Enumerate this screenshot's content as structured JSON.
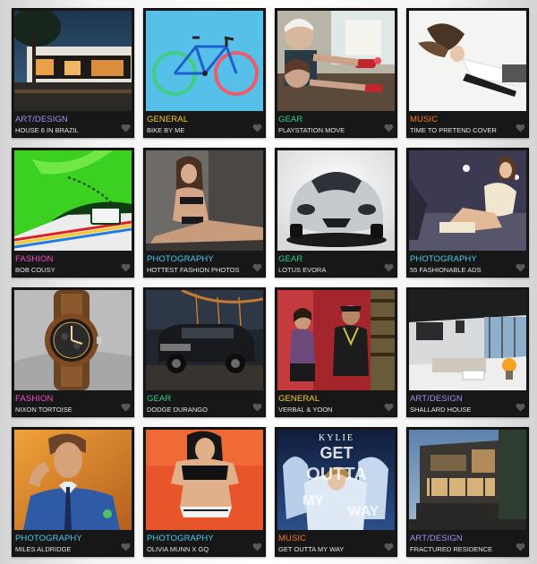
{
  "categories": {
    "art_design": {
      "label": "ART/DESIGN",
      "color": "#a58ef5"
    },
    "general": {
      "label": "GENERAL",
      "color": "#f5cf2c"
    },
    "gear": {
      "label": "GEAR",
      "color": "#35d08a"
    },
    "music": {
      "label": "MUSIC",
      "color": "#f27a2a"
    },
    "fashion": {
      "label": "FASHION",
      "color": "#f04fcf"
    },
    "photography": {
      "label": "PHOTOGRAPHY",
      "color": "#4ecbf0"
    }
  },
  "posts": [
    {
      "category": "ART/DESIGN",
      "title": "HOUSE 6 IN BRAZIL"
    },
    {
      "category": "GENERAL",
      "title": "BIKE BY ME"
    },
    {
      "category": "GEAR",
      "title": "PLAYSTATION MOVE"
    },
    {
      "category": "MUSIC",
      "title": "TIME TO PRETEND COVER"
    },
    {
      "category": "FASHION",
      "title": "BOB COUSY"
    },
    {
      "category": "PHOTOGRAPHY",
      "title": "HOTTEST FASHION PHOTOS"
    },
    {
      "category": "GEAR",
      "title": "LOTUS EVORA"
    },
    {
      "category": "PHOTOGRAPHY",
      "title": "55 FASHIONABLE ADS"
    },
    {
      "category": "FASHION",
      "title": "NIXON TORTOISE"
    },
    {
      "category": "GEAR",
      "title": "DODGE DURANGO"
    },
    {
      "category": "GENERAL",
      "title": "VERBAL & YOON"
    },
    {
      "category": "ART/DESIGN",
      "title": "SHALLARD HOUSE"
    },
    {
      "category": "PHOTOGRAPHY",
      "title": "MILES ALDRIDGE"
    },
    {
      "category": "PHOTOGRAPHY",
      "title": "OLIVIA MUNN X GQ"
    },
    {
      "category": "MUSIC",
      "title": "GET OUTTA MY WAY"
    },
    {
      "category": "ART/DESIGN",
      "title": "FRACTURED RESIDENCE"
    }
  ],
  "album_cover": {
    "artist": "KYLIE",
    "words": [
      "GET",
      "OUTTA",
      "MY",
      "WAY"
    ]
  },
  "icons": {
    "like": "heart-icon"
  }
}
